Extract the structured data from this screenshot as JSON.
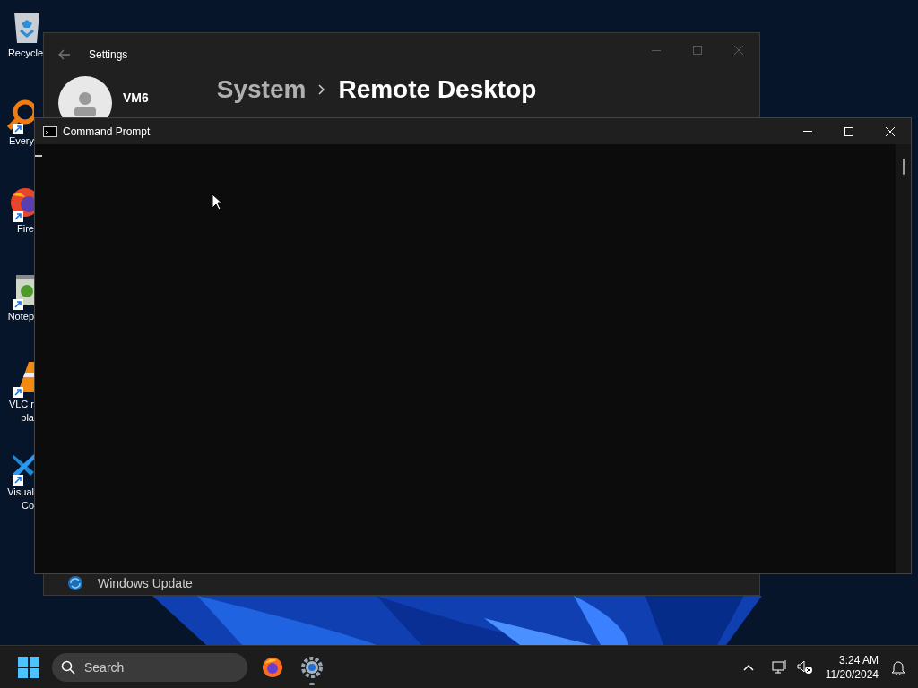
{
  "desktop_icons": [
    {
      "kind": "recycle",
      "lines": [
        "Recycle"
      ],
      "shortcut": false
    },
    {
      "kind": "everything",
      "lines": [
        "Every"
      ],
      "shortcut": true
    },
    {
      "kind": "firefox",
      "lines": [
        "Fire"
      ],
      "shortcut": true
    },
    {
      "kind": "notepad",
      "lines": [
        "Notep"
      ],
      "shortcut": true
    },
    {
      "kind": "vlc",
      "lines": [
        "VLC r",
        "pla"
      ],
      "shortcut": true
    },
    {
      "kind": "vscode",
      "lines": [
        "Visual",
        "Co"
      ],
      "shortcut": true
    }
  ],
  "settings_window": {
    "title": "Settings",
    "user": "VM6",
    "breadcrumb": [
      "System",
      "Remote Desktop"
    ],
    "sidebar_items": [
      {
        "label": "Windows Update"
      }
    ]
  },
  "cmd_window": {
    "title": "Command Prompt"
  },
  "taskbar": {
    "search": {
      "placeholder": "Search"
    },
    "apps": [
      {
        "kind": "firefox",
        "running": false
      },
      {
        "kind": "settings",
        "running": true
      }
    ],
    "time": "3:24 AM",
    "date": "11/20/2024"
  }
}
